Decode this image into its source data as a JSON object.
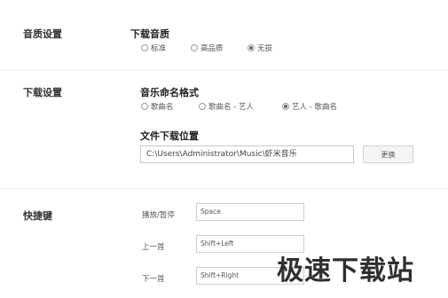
{
  "sections": {
    "audio_quality": {
      "label": "音质设置",
      "download_quality": {
        "title": "下载音质",
        "options": [
          {
            "label": "标准",
            "checked": false
          },
          {
            "label": "高品质",
            "checked": false
          },
          {
            "label": "无损",
            "checked": true
          }
        ]
      }
    },
    "download": {
      "label": "下载设置",
      "naming": {
        "title": "音乐命名格式",
        "options": [
          {
            "label": "歌曲名",
            "checked": false
          },
          {
            "label": "歌曲名 - 艺人",
            "checked": false
          },
          {
            "label": "艺人 - 歌曲名",
            "checked": true
          }
        ]
      },
      "location": {
        "title": "文件下载位置",
        "path": "C:\\Users\\Administrator\\Music\\虾米音乐",
        "change_button": "更换"
      }
    },
    "hotkeys": {
      "label": "快捷键",
      "items": [
        {
          "label": "播放/暂停",
          "value": "Space"
        },
        {
          "label": "上一首",
          "value": "Shift+Left"
        },
        {
          "label": "下一首",
          "value": "Shift+Right"
        }
      ]
    }
  },
  "watermark": "极速下载站"
}
